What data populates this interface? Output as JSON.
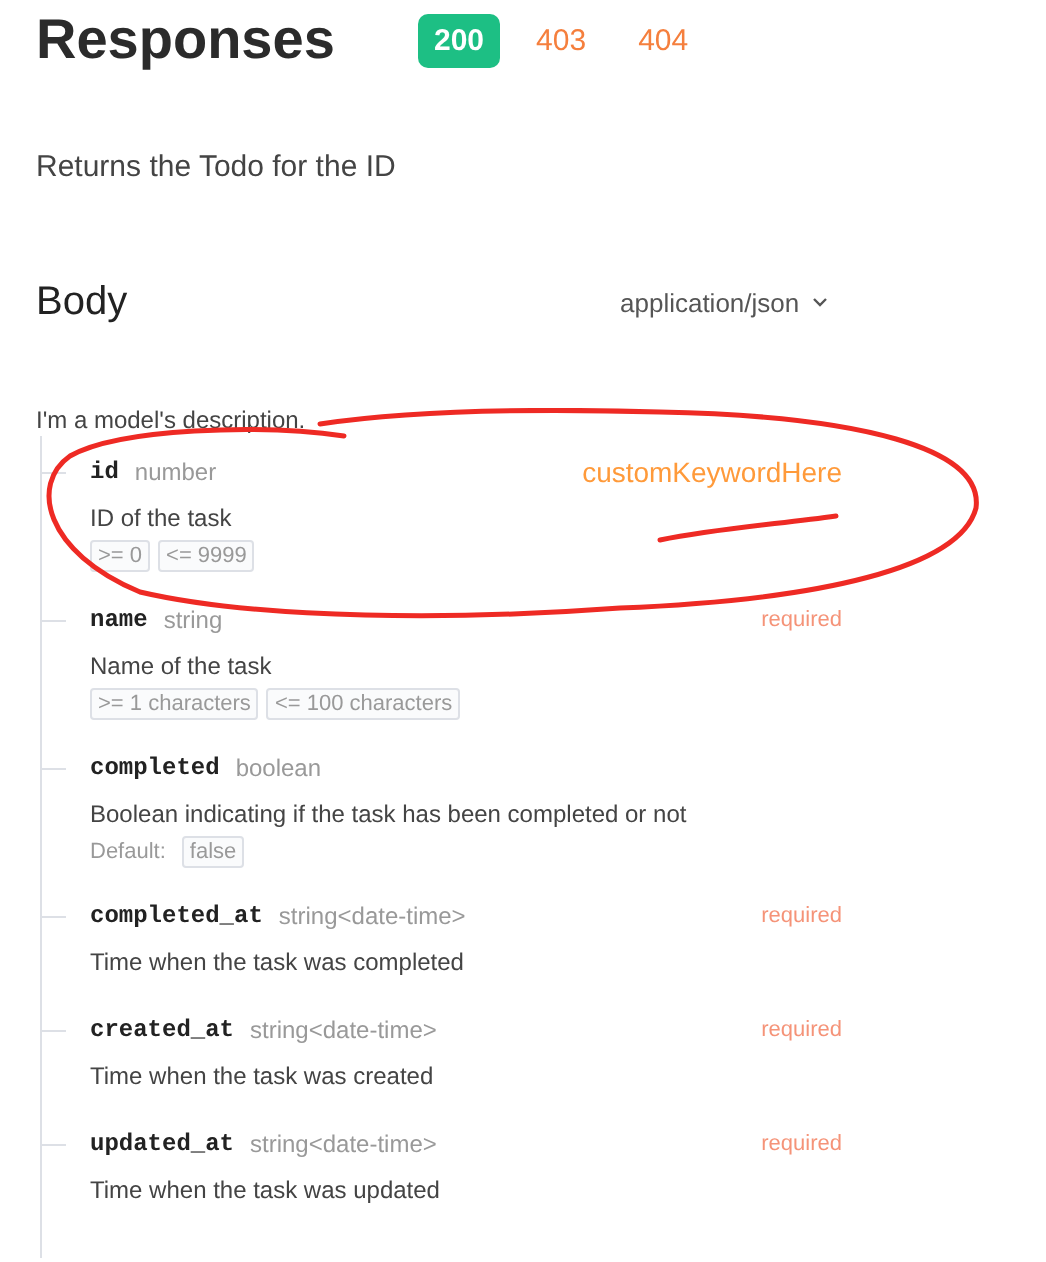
{
  "title": "Responses",
  "status_tabs": [
    {
      "label": "200",
      "selected": true
    },
    {
      "label": "403",
      "selected": false
    },
    {
      "label": "404",
      "selected": false
    }
  ],
  "description": "Returns the Todo for the ID",
  "body": {
    "heading": "Body",
    "content_type": "application/json",
    "model_description": "I'm a model's description.",
    "properties": [
      {
        "name": "id",
        "type": "number",
        "note": "customKeywordHere",
        "description": "ID of the task",
        "constraints": [
          ">= 0",
          "<= 9999"
        ]
      },
      {
        "name": "name",
        "type": "string",
        "badge": "required",
        "description": "Name of the task",
        "constraints": [
          ">= 1 characters",
          "<= 100 characters"
        ]
      },
      {
        "name": "completed",
        "type": "boolean",
        "description": "Boolean indicating if the task has been completed or not",
        "default": {
          "label": "Default:",
          "value": "false"
        }
      },
      {
        "name": "completed_at",
        "type": "string<date-time>",
        "badge": "required",
        "description": "Time when the task was completed"
      },
      {
        "name": "created_at",
        "type": "string<date-time>",
        "badge": "required",
        "description": "Time when the task was created"
      },
      {
        "name": "updated_at",
        "type": "string<date-time>",
        "badge": "required",
        "description": "Time when the task was updated"
      }
    ]
  }
}
